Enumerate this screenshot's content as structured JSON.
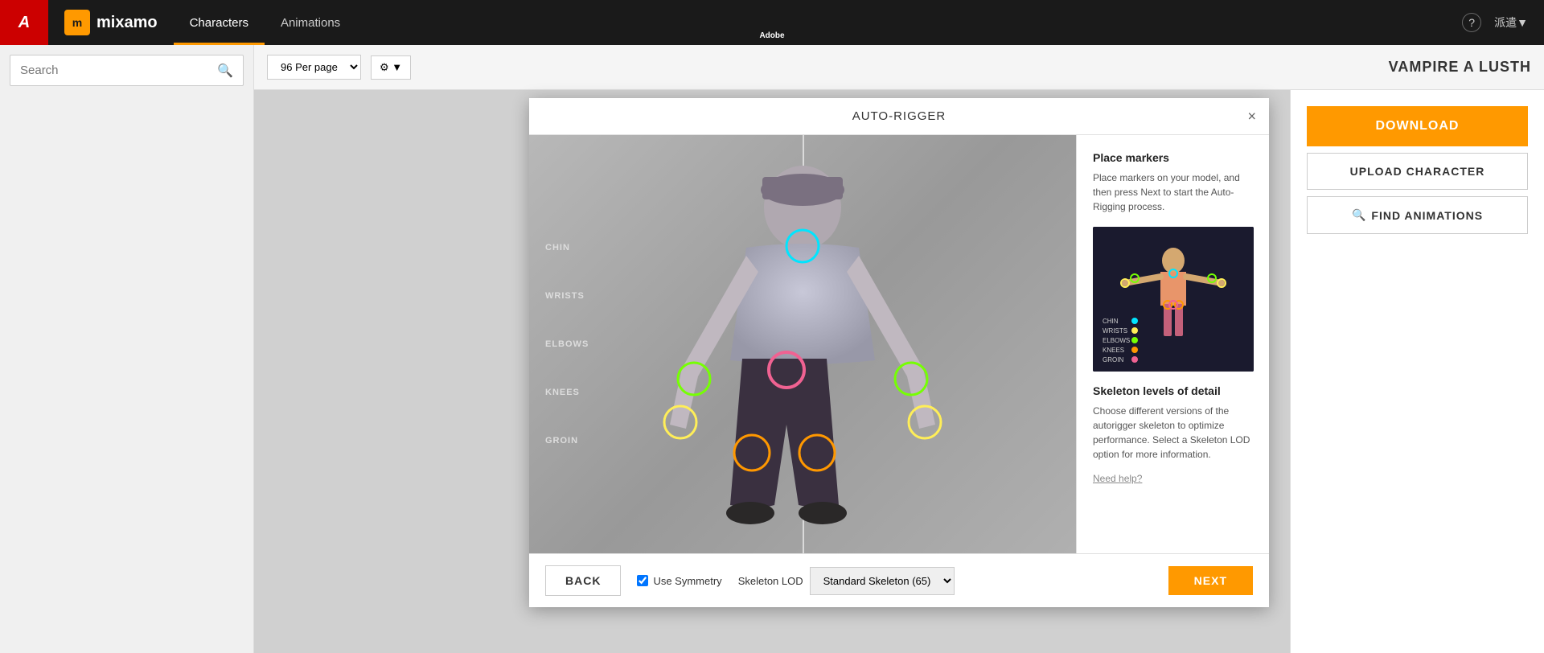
{
  "nav": {
    "brand": "mixamo",
    "tabs": [
      {
        "id": "characters",
        "label": "Characters",
        "active": true
      },
      {
        "id": "animations",
        "label": "Animations",
        "active": false
      }
    ],
    "help_icon": "?",
    "user_label": "派遣▼"
  },
  "search": {
    "placeholder": "Search",
    "value": ""
  },
  "top_bar": {
    "per_page": "96 Per page",
    "character_name": "VAMPIRE A LUSTH"
  },
  "right_panel": {
    "download_label": "DOWNLOAD",
    "upload_label": "UPLOAD CHARACTER",
    "find_animations_label": "FIND ANIMATIONS"
  },
  "modal": {
    "title": "AUTO-RIGGER",
    "close_label": "×",
    "place_markers": {
      "title": "Place markers",
      "description": "Place markers on your model, and then press Next to start the Auto-Rigging process."
    },
    "legend": {
      "items": [
        {
          "label": "CHIN",
          "color": "#00e5ff"
        },
        {
          "label": "WRISTS",
          "color": "#ffee58"
        },
        {
          "label": "ELBOWS",
          "color": "#76ff03"
        },
        {
          "label": "KNEES",
          "color": "#ff9800"
        },
        {
          "label": "GROIN",
          "color": "#f06292"
        }
      ]
    },
    "skeleton": {
      "title": "Skeleton levels of detail",
      "description": "Choose different versions of the autorigger skeleton to optimize performance. Select a Skeleton LOD option for more information.",
      "need_help": "Need help?"
    },
    "footer": {
      "back_label": "BACK",
      "symmetry_label": "Use Symmetry",
      "symmetry_checked": true,
      "skeleton_lod_label": "Skeleton LOD",
      "skeleton_option": "Standard Skeleton (65)",
      "next_label": "NEXT"
    },
    "marker_labels": [
      "CHIN",
      "WRISTS",
      "ELBOWS",
      "KNEES",
      "GROIN"
    ]
  }
}
